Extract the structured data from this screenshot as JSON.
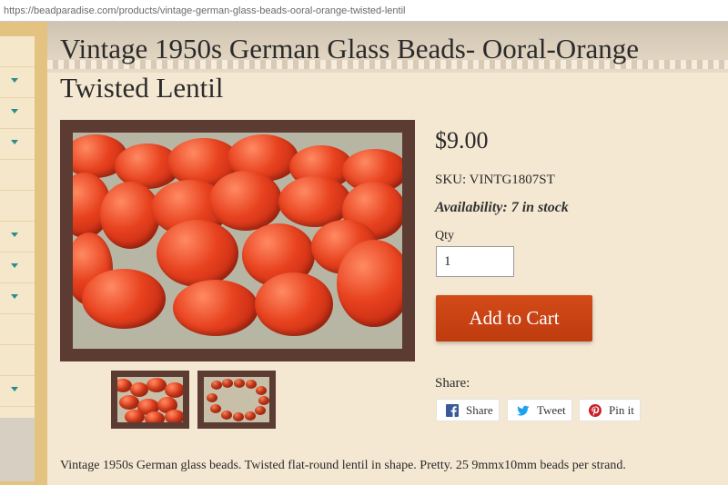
{
  "browser": {
    "url": "https://beadparadise.com/products/vintage-german-glass-beads-ooral-orange-twisted-lentil"
  },
  "product": {
    "title": "Vintage 1950s German Glass Beads- Ooral-Orange Twisted Lentil",
    "price": "$9.00",
    "sku": "SKU: VINTG1807ST",
    "availability": "Availability: 7 in stock",
    "qty_label": "Qty",
    "qty_value": "1",
    "add_to_cart": "Add to Cart",
    "description": "Vintage 1950s German glass beads.  Twisted flat-round lentil in shape.  Pretty.  25 9mmx10mm beads per strand."
  },
  "share": {
    "label": "Share:",
    "buttons": [
      {
        "label": "Share",
        "icon": "facebook-icon",
        "color": "#3b5998"
      },
      {
        "label": "Tweet",
        "icon": "twitter-icon",
        "color": "#1da1f2"
      },
      {
        "label": "Pin it",
        "icon": "pinterest-icon",
        "color": "#cb2027"
      }
    ]
  },
  "colors": {
    "add_to_cart_bg": "#c8431a",
    "sidebar_chevron": "#2f8a8f",
    "frame": "#5b3b32"
  }
}
